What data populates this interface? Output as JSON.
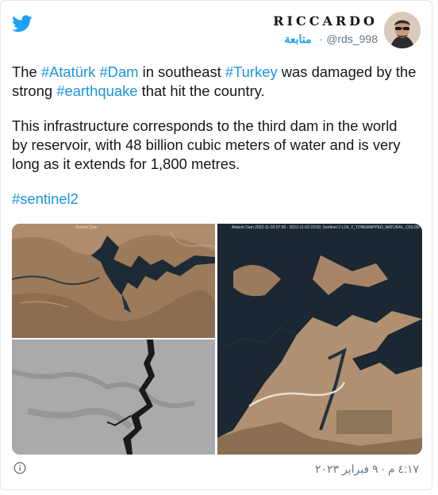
{
  "icons": {
    "brand": "twitter-bird-icon",
    "info": "info-circle-icon"
  },
  "colors": {
    "link": "#1b95e0",
    "accent": "#1da1f2",
    "muted": "#657786",
    "text": "#14171a"
  },
  "author": {
    "display_name": "RICCARDO",
    "handle": "@rds_998",
    "follow_label": "متابعة"
  },
  "tweet": {
    "p1": {
      "t1": "The ",
      "h1": "#Atatürk",
      "t2": " ",
      "h2": "#Dam",
      "t3": " in southeast ",
      "h3": "#Turkey",
      "t4": " was damaged by the strong ",
      "h4": "#earthquake",
      "t5": " that hit the country."
    },
    "p2": "This infrastructure corresponds to the third dam in the world by reservoir, with 48 billion cubic meters of water and is very long as it extends for 1,800 metres.",
    "p3": "#sentinel2"
  },
  "media": {
    "image1_caption": "Ataturk Dam",
    "image3_caption": "Ataturk Dam  2022-11-03 07:50 - 2022-11-03 23:59, Sentinel-2 L2A, 2_TONEMAPPED_NATURAL_COLOR"
  },
  "footer": {
    "timestamp": "٤:١٧ م · ٩ فبراير ٢٠٢٣"
  }
}
